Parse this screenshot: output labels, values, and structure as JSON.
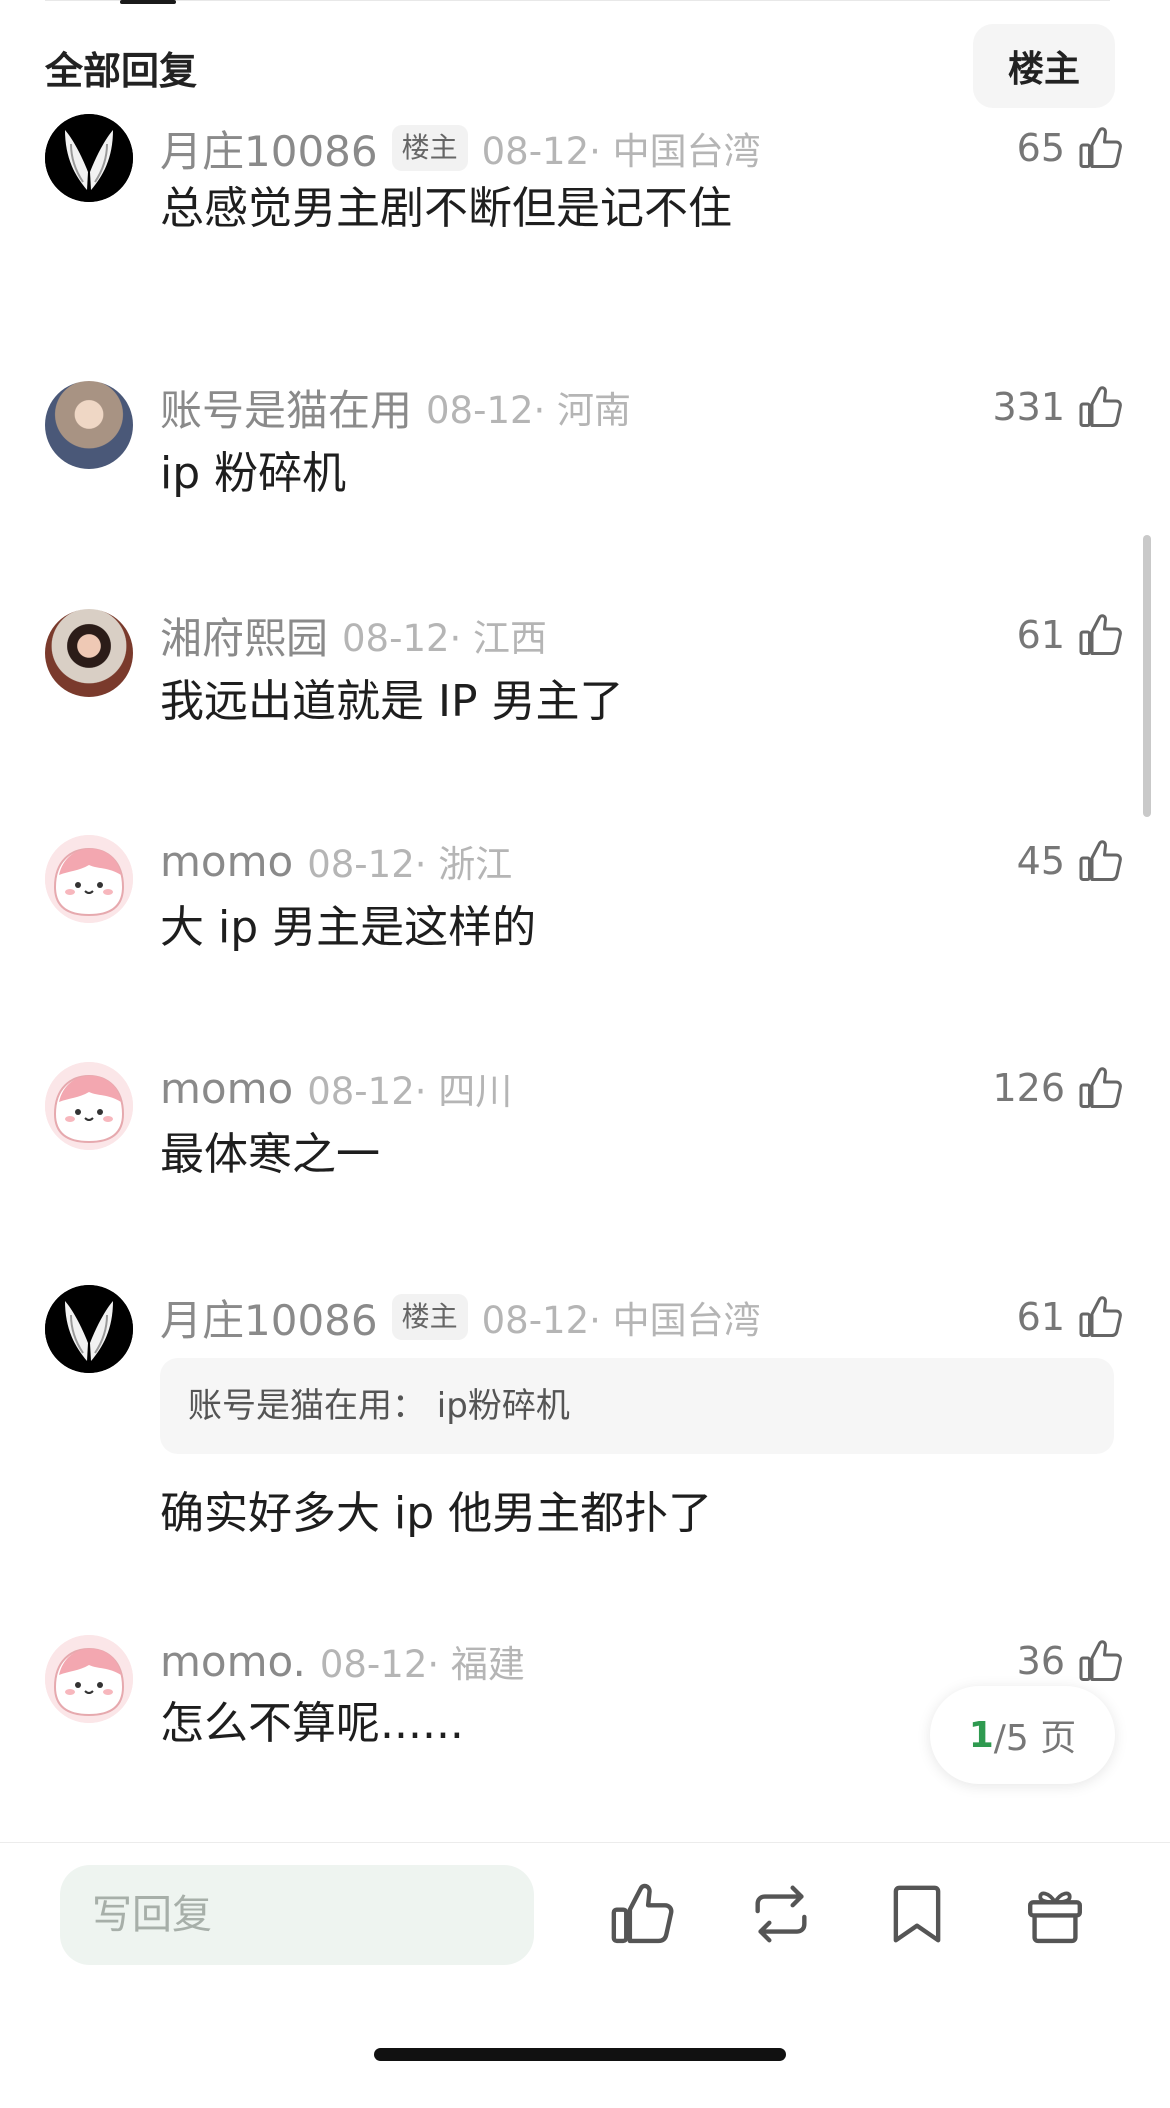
{
  "header": {
    "title": "全部回复",
    "filter_label": "楼主"
  },
  "comments": [
    {
      "username": "月庄10086",
      "op_badge": "楼主",
      "time": "08-12· 中国台湾",
      "likes": "65",
      "content": "总感觉男主剧不断但是记不住",
      "avatar": "wings-avatar"
    },
    {
      "username": "账号是猫在用",
      "time": "08-12· 河南",
      "likes": "331",
      "content": "ip 粉碎机",
      "avatar": "girl-avatar"
    },
    {
      "username": "湘府熙园",
      "time": "08-12· 江西",
      "likes": "61",
      "content": "我远出道就是 IP 男主了",
      "avatar": "girl-avatar"
    },
    {
      "username": "momo",
      "time": "08-12· 浙江",
      "likes": "45",
      "content": "大 ip 男主是这样的",
      "avatar": "momo-avatar"
    },
    {
      "username": "momo",
      "time": "08-12· 四川",
      "likes": "126",
      "content": "最体寒之一",
      "avatar": "momo-avatar"
    },
    {
      "username": "月庄10086",
      "op_badge": "楼主",
      "time": "08-12· 中国台湾",
      "likes": "61",
      "quote": "账号是猫在用： ip粉碎机",
      "content": "确实好多大 ip 他男主都扑了",
      "avatar": "wings-avatar"
    },
    {
      "username": "momo.",
      "time": "08-12· 福建",
      "likes": "36",
      "content": "怎么不算呢......",
      "avatar": "momo-avatar"
    }
  ],
  "pagination": {
    "current": "1",
    "total": "/5 页"
  },
  "bottom_bar": {
    "reply_placeholder": "写回复",
    "icons": [
      "thumbs-up-icon",
      "repost-icon",
      "bookmark-icon",
      "gift-icon"
    ]
  },
  "colors": {
    "accent": "#2f9a50",
    "input_bg": "#eef4f0"
  }
}
